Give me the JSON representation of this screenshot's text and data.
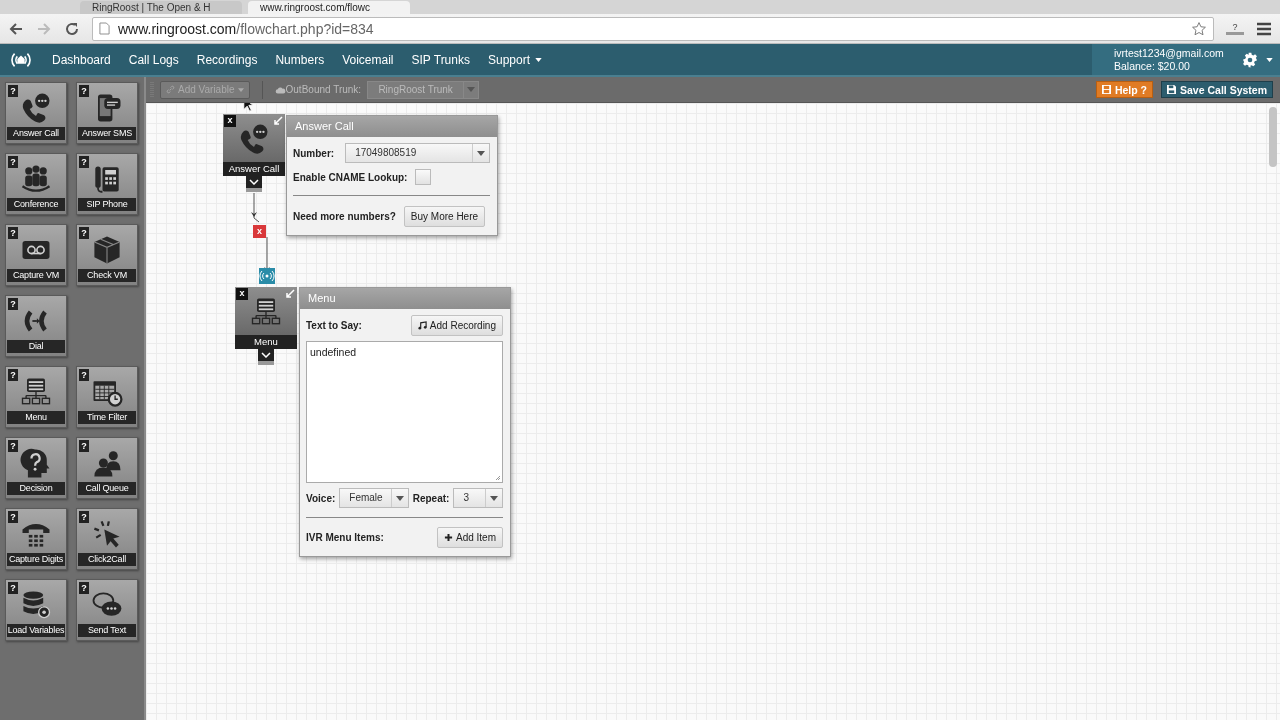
{
  "browser": {
    "tabs": [
      {
        "title": "RingRoost | The Open & H",
        "selected": false
      },
      {
        "title": "www.ringroost.com/flowc",
        "selected": true
      }
    ],
    "url_host": "www.ringroost.com",
    "url_path": "/flowchart.php?id=834",
    "extension_badge": "?"
  },
  "nav": {
    "items": [
      {
        "label": "Dashboard",
        "kind": "link"
      },
      {
        "label": "Call Logs",
        "kind": "link"
      },
      {
        "label": "Recordings",
        "kind": "link"
      },
      {
        "label": "Numbers",
        "kind": "link"
      },
      {
        "label": "Voicemail",
        "kind": "link"
      },
      {
        "label": "SIP Trunks",
        "kind": "link"
      },
      {
        "label": "Support",
        "kind": "dropdown"
      }
    ],
    "account": {
      "email": "ivrtest1234@gmail.com",
      "balance": "Balance: $20.00"
    }
  },
  "toolbar": {
    "add_variable": "Add Variable",
    "trunk_label": "OutBound Trunk:",
    "trunk_value": "RingRoost Trunk",
    "help": "Help ?",
    "save": "Save Call System"
  },
  "palette": [
    {
      "tiles": [
        {
          "label": "Answer Call",
          "kind": "answer-call",
          "badge": "?"
        },
        {
          "label": "Answer SMS",
          "kind": "answer-sms",
          "badge": "?"
        }
      ]
    },
    {
      "tiles": [
        {
          "label": "Conference",
          "kind": "conference",
          "badge": "?"
        },
        {
          "label": "SIP Phone",
          "kind": "sip-phone",
          "badge": "?"
        }
      ]
    },
    {
      "tiles": [
        {
          "label": "Capture VM",
          "kind": "capture-vm",
          "badge": "?"
        },
        {
          "label": "Check VM",
          "kind": "check-vm",
          "badge": "?"
        }
      ]
    },
    {
      "tiles": [
        {
          "label": "Dial",
          "kind": "dial",
          "badge": "?"
        }
      ]
    },
    {
      "tiles": [
        {
          "label": "Menu",
          "kind": "menu",
          "badge": "?"
        },
        {
          "label": "Time Filter",
          "kind": "time-filter",
          "badge": "?"
        }
      ]
    },
    {
      "tiles": [
        {
          "label": "Decision",
          "kind": "decision",
          "badge": "?"
        },
        {
          "label": "Call Queue",
          "kind": "call-queue",
          "badge": "?"
        }
      ]
    },
    {
      "tiles": [
        {
          "label": "Capture Digits",
          "kind": "capture-digits",
          "badge": "?"
        },
        {
          "label": "Click2Call",
          "kind": "click2call",
          "badge": "?"
        }
      ]
    },
    {
      "tiles": [
        {
          "label": "Load Variables",
          "kind": "load-variables",
          "badge": "?"
        },
        {
          "label": "Send Text",
          "kind": "send-text",
          "badge": "?"
        }
      ]
    }
  ],
  "flow": {
    "nodes": [
      {
        "label": "Answer Call",
        "kind": "answer-call",
        "close": "x"
      },
      {
        "label": "Menu",
        "kind": "menu",
        "close": "x"
      }
    ],
    "link_delete": "x",
    "answer_call_panel": {
      "title": "Answer Call",
      "number_label": "Number:",
      "number_value": "17049808519",
      "cname_label": "Enable CNAME Lookup:",
      "cname_checked": false,
      "more_label": "Need more numbers?",
      "buy_button": "Buy More Here"
    },
    "menu_panel": {
      "title": "Menu",
      "text_label": "Text to Say:",
      "add_recording": "Add Recording",
      "text_value": "undefined",
      "voice_label": "Voice:",
      "voice_value": "Female",
      "repeat_label": "Repeat:",
      "repeat_value": "3",
      "items_label": "IVR Menu Items:",
      "add_item": "Add Item"
    }
  }
}
